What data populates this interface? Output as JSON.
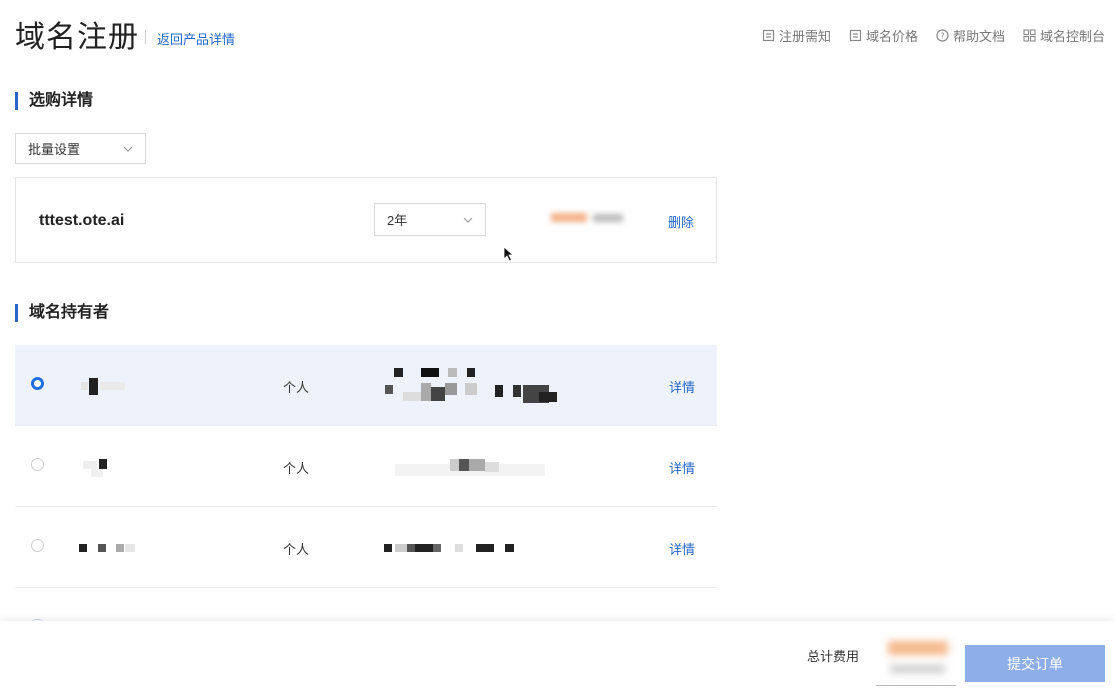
{
  "header": {
    "title": "域名注册",
    "back_link": "返回产品详情",
    "links": [
      {
        "label": "注册需知",
        "icon": "document-icon"
      },
      {
        "label": "域名价格",
        "icon": "document-icon"
      },
      {
        "label": "帮助文档",
        "icon": "question-circle-icon"
      },
      {
        "label": "域名控制台",
        "icon": "grid-icon"
      }
    ]
  },
  "purchase": {
    "heading": "选购详情",
    "batch_select": "批量设置",
    "item": {
      "domain": "tttest.ote.ai",
      "period": "2年",
      "delete_label": "删除"
    }
  },
  "holders": {
    "heading": "域名持有者",
    "rows": [
      {
        "type": "个人",
        "detail_label": "详情",
        "selected": true
      },
      {
        "type": "个人",
        "detail_label": "详情",
        "selected": false
      },
      {
        "type": "个人",
        "detail_label": "详情",
        "selected": false
      }
    ]
  },
  "footer": {
    "total_label": "总计费用",
    "submit_label": "提交订单"
  },
  "colors": {
    "accent": "#2468c9",
    "submit_bg": "#8eaeea",
    "selected_row_bg": "#eef3fb",
    "section_bar": "#2b64c5"
  }
}
